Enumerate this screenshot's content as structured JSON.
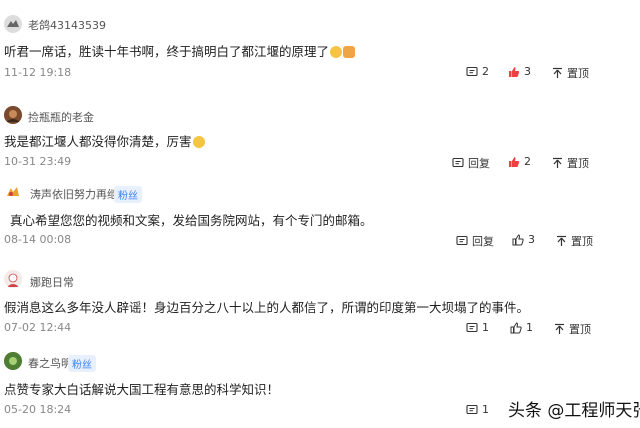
{
  "comments": [
    {
      "username": "老鸽43143539",
      "badge": "",
      "text": "听君一席话，胜读十年书啊，终于搞明白了都江堰的原理了",
      "date": "11-12 19:18",
      "reply_label": "2",
      "like_count": "3",
      "like_active": true,
      "pin_label": "置顶"
    },
    {
      "username": "捡瓶瓶的老金",
      "badge": "",
      "text": "我是都江堰人都没得你清楚，厉害",
      "date": "10-31 23:49",
      "reply_label": "回复",
      "like_count": "2",
      "like_active": true,
      "pin_label": "置顶"
    },
    {
      "username": "涛声依旧努力再继续",
      "badge": "粉丝",
      "text": "真心希望您您的视频和文案，发给国务院网站，有个专门的邮箱。",
      "date": "08-14 00:08",
      "reply_label": "回复",
      "like_count": "3",
      "like_active": false,
      "pin_label": "置顶"
    },
    {
      "username": "娜跑日常",
      "badge": "",
      "text": "假消息这么多年没人辟谣！身边百分之八十以上的人都信了，所谓的印度第一大坝塌了的事件。",
      "date": "07-02 12:44",
      "reply_label": "1",
      "like_count": "1",
      "like_active": false,
      "pin_label": "置顶"
    },
    {
      "username": "春之鸟明",
      "badge": "粉丝",
      "text": "点赞专家大白话解说大国工程有意思的科学知识！",
      "date": "05-20 18:24",
      "reply_label": "1",
      "like_count": "",
      "like_active": false,
      "pin_label": ""
    }
  ],
  "watermark": "头条 @工程师天张",
  "colors": {
    "like_active": "#f04142",
    "icon": "#333333",
    "badge_text": "#3b82f6"
  }
}
